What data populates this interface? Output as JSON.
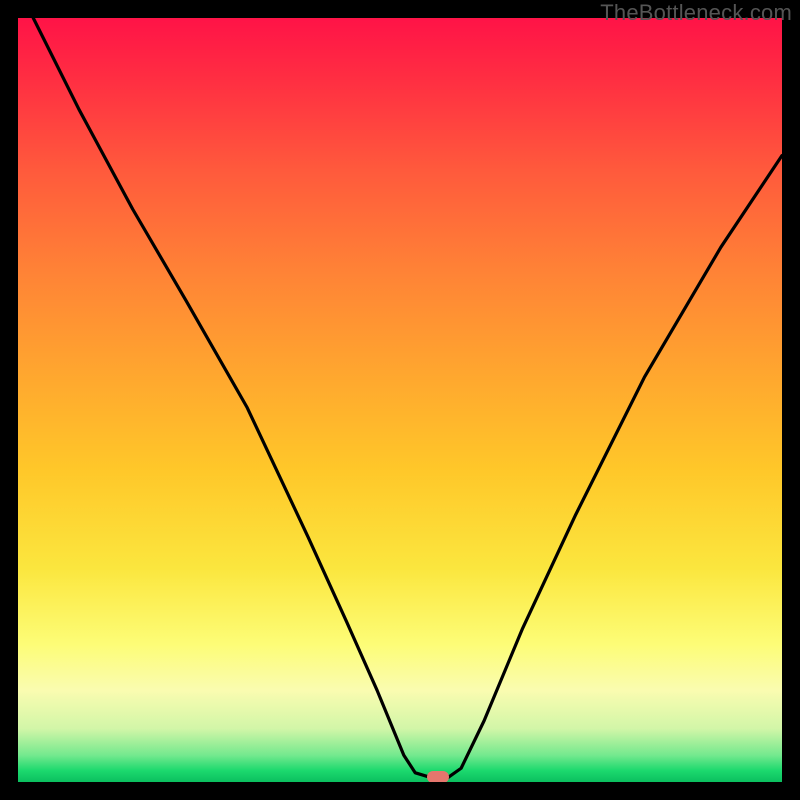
{
  "watermark": "TheBottleneck.com",
  "chart_data": {
    "type": "line",
    "title": "",
    "xlabel": "",
    "ylabel": "",
    "xlim": [
      0,
      100
    ],
    "ylim": [
      0,
      100
    ],
    "grid": false,
    "legend": false,
    "series": [
      {
        "name": "curve",
        "x": [
          2,
          8,
          15,
          22,
          30,
          38,
          43,
          47,
          50.5,
          52,
          54,
          56.3,
          58,
          61,
          66,
          73,
          82,
          92,
          100
        ],
        "values": [
          100,
          88,
          75,
          63,
          49,
          32,
          21,
          12,
          3.5,
          1.2,
          0.6,
          0.6,
          1.8,
          8,
          20,
          35,
          53,
          70,
          82
        ]
      }
    ],
    "markers": [
      {
        "name": "bottleneck-marker",
        "x": 55,
        "y": 0.6,
        "color": "#e5766d"
      }
    ],
    "colors": {
      "line": "#000000",
      "gradient_top": "#ff1347",
      "gradient_bottom": "#0bbf5f"
    }
  }
}
